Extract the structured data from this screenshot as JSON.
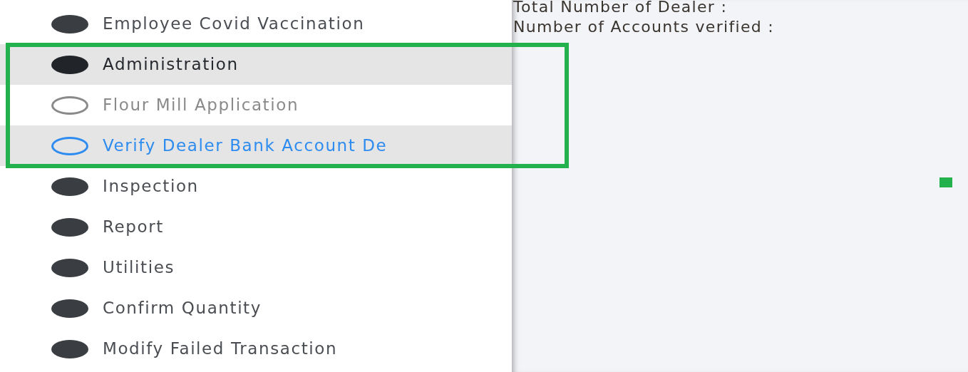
{
  "sidebar": {
    "items": [
      {
        "label": "Employee Covid Vaccination",
        "expanded": false
      },
      {
        "label": "Administration",
        "expanded": true,
        "children": [
          {
            "label": "Flour Mill Application",
            "selected": false
          },
          {
            "label": "Verify Dealer Bank Account De",
            "selected": true
          }
        ]
      },
      {
        "label": "Inspection",
        "expanded": false
      },
      {
        "label": "Report",
        "expanded": false
      },
      {
        "label": "Utilities",
        "expanded": false
      },
      {
        "label": "Confirm Quantity",
        "expanded": false
      },
      {
        "label": "Modify Failed Transaction",
        "expanded": false
      }
    ]
  },
  "main": {
    "fields": [
      {
        "label": "Total Number of Dealer :"
      },
      {
        "label": "Number of Accounts verified :"
      }
    ]
  }
}
